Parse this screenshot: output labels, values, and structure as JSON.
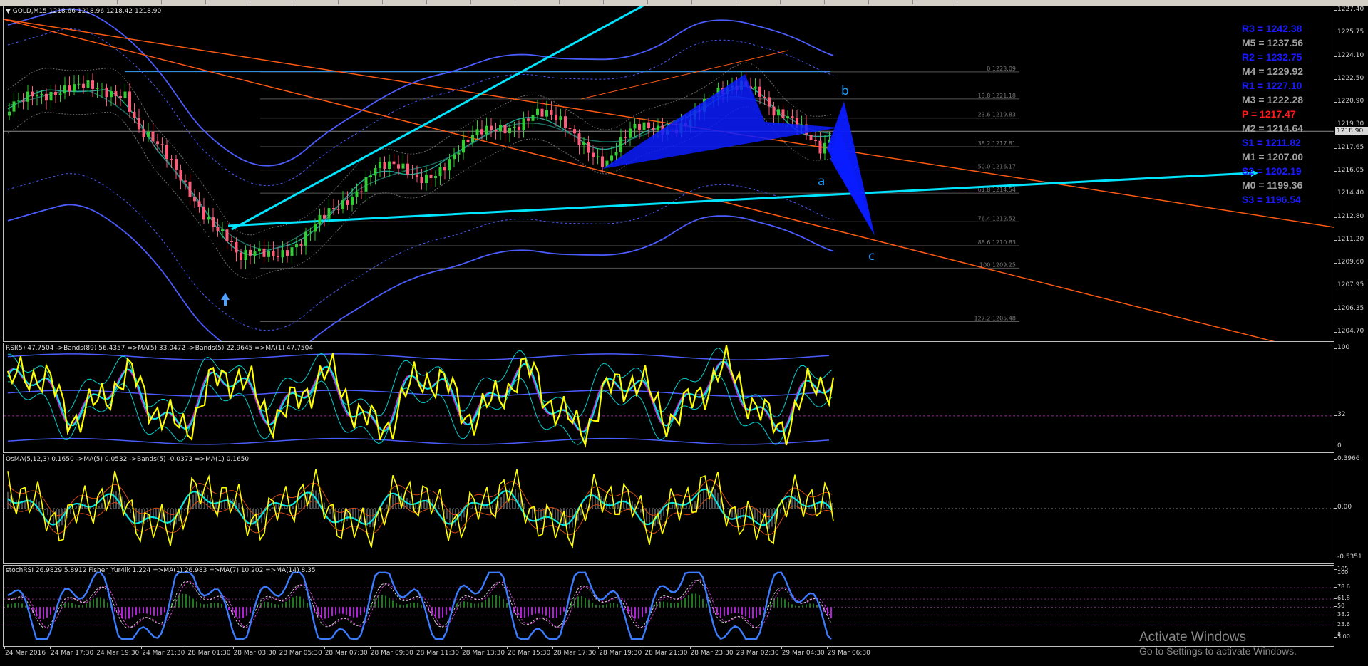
{
  "window": {
    "symbol_label": "GOLD,M15",
    "ohlc": "1218.66 1218.96 1218.42 1218.90",
    "current_price": "1218.90"
  },
  "price_axis": {
    "labels": [
      "1227.40",
      "1225.75",
      "1224.10",
      "1222.50",
      "1220.90",
      "1219.30",
      "1217.65",
      "1216.05",
      "1214.40",
      "1212.80",
      "1211.20",
      "1209.60",
      "1207.95",
      "1206.35",
      "1204.70"
    ],
    "max": 1227.4,
    "min": 1204.7
  },
  "pivots": [
    {
      "label": "R3 = 1242.38",
      "color": "#1a1aff"
    },
    {
      "label": "M5 = 1237.56",
      "color": "#a0a0a0"
    },
    {
      "label": "R2 = 1232.75",
      "color": "#1a1aff"
    },
    {
      "label": "M4 = 1229.92",
      "color": "#a0a0a0"
    },
    {
      "label": "R1 = 1227.10",
      "color": "#1a1aff"
    },
    {
      "label": "M3 = 1222.28",
      "color": "#a0a0a0"
    },
    {
      "label": "P   = 1217.47",
      "color": "#ff1a1a"
    },
    {
      "label": "M2 = 1214.64",
      "color": "#a0a0a0"
    },
    {
      "label": "S1 = 1211.82",
      "color": "#1a1aff"
    },
    {
      "label": "M1 = 1207.00",
      "color": "#a0a0a0"
    },
    {
      "label": "S2 = 1202.19",
      "color": "#1a1aff"
    },
    {
      "label": "M0 = 1199.36",
      "color": "#a0a0a0"
    },
    {
      "label": "S3 = 1196.54",
      "color": "#1a1aff"
    }
  ],
  "fibonacci": [
    {
      "label": "0 1223.09",
      "price": 1223.09
    },
    {
      "label": "13.8 1221.18",
      "price": 1221.18
    },
    {
      "label": "23.6 1219.83",
      "price": 1219.83
    },
    {
      "label": "38.2 1217.81",
      "price": 1217.81
    },
    {
      "label": "50.0 1216.17",
      "price": 1216.17
    },
    {
      "label": "61.8 1214.54",
      "price": 1214.54
    },
    {
      "label": "76.4 1212.52",
      "price": 1212.52
    },
    {
      "label": "88.6 1210.83",
      "price": 1210.83
    },
    {
      "label": "100 1209.25",
      "price": 1209.25
    },
    {
      "label": "127.2 1205.48",
      "price": 1205.48
    }
  ],
  "pattern_labels": {
    "a": "a",
    "b": "b",
    "c": "c"
  },
  "rsi": {
    "header": "RSI(5) 47.7504  ->Bands(89) 56.4357  =>MA(5) 33.0472  ->Bands(5) 22.9645  =>MA(1) 47.7504",
    "axis": [
      "100",
      "32",
      "0"
    ],
    "level": 32
  },
  "osma": {
    "header": "OsMA(5,12,3) 0.1650  ->MA(5) 0.0532  ->Bands(5) -0.0373  =>MA(1) 0.1650",
    "axis": [
      "0.3966",
      "0.00",
      "-0.5351"
    ]
  },
  "stoch": {
    "header": "stochRSI 26.9829 5.8912  Fisher_Yur4ik 1.224  =>MA(1) 26.983  =>MA(7) 10.202  =>MA(14) 8.35",
    "axis": [
      "105",
      "100",
      "78.6",
      "61.8",
      "50",
      "38.2",
      "23.6",
      "8",
      "5.00"
    ]
  },
  "time_axis": [
    "24 Mar 2016",
    "24 Mar 17:30",
    "24 Mar 19:30",
    "24 Mar 21:30",
    "28 Mar 01:30",
    "28 Mar 03:30",
    "28 Mar 05:30",
    "28 Mar 07:30",
    "28 Mar 09:30",
    "28 Mar 11:30",
    "28 Mar 13:30",
    "28 Mar 15:30",
    "28 Mar 17:30",
    "28 Mar 19:30",
    "28 Mar 21:30",
    "28 Mar 23:30",
    "29 Mar 02:30",
    "29 Mar 04:30",
    "29 Mar 06:30"
  ],
  "watermark": {
    "title": "Activate Windows",
    "subtitle": "Go to Settings to activate Windows."
  },
  "colors": {
    "bull_candle": "#32cd32",
    "bear_candle": "#ff5c7a",
    "trendline": "#00e5ff",
    "channel": "#ff5a14",
    "bands": "#4b5cff",
    "pattern": "#0a1cff",
    "rsi_line": "#ffff00",
    "ma_line": "#00e5e5"
  },
  "chart_data": {
    "type": "candlestick",
    "title": "GOLD,M15",
    "ylim": [
      1204.7,
      1227.4
    ]
  }
}
